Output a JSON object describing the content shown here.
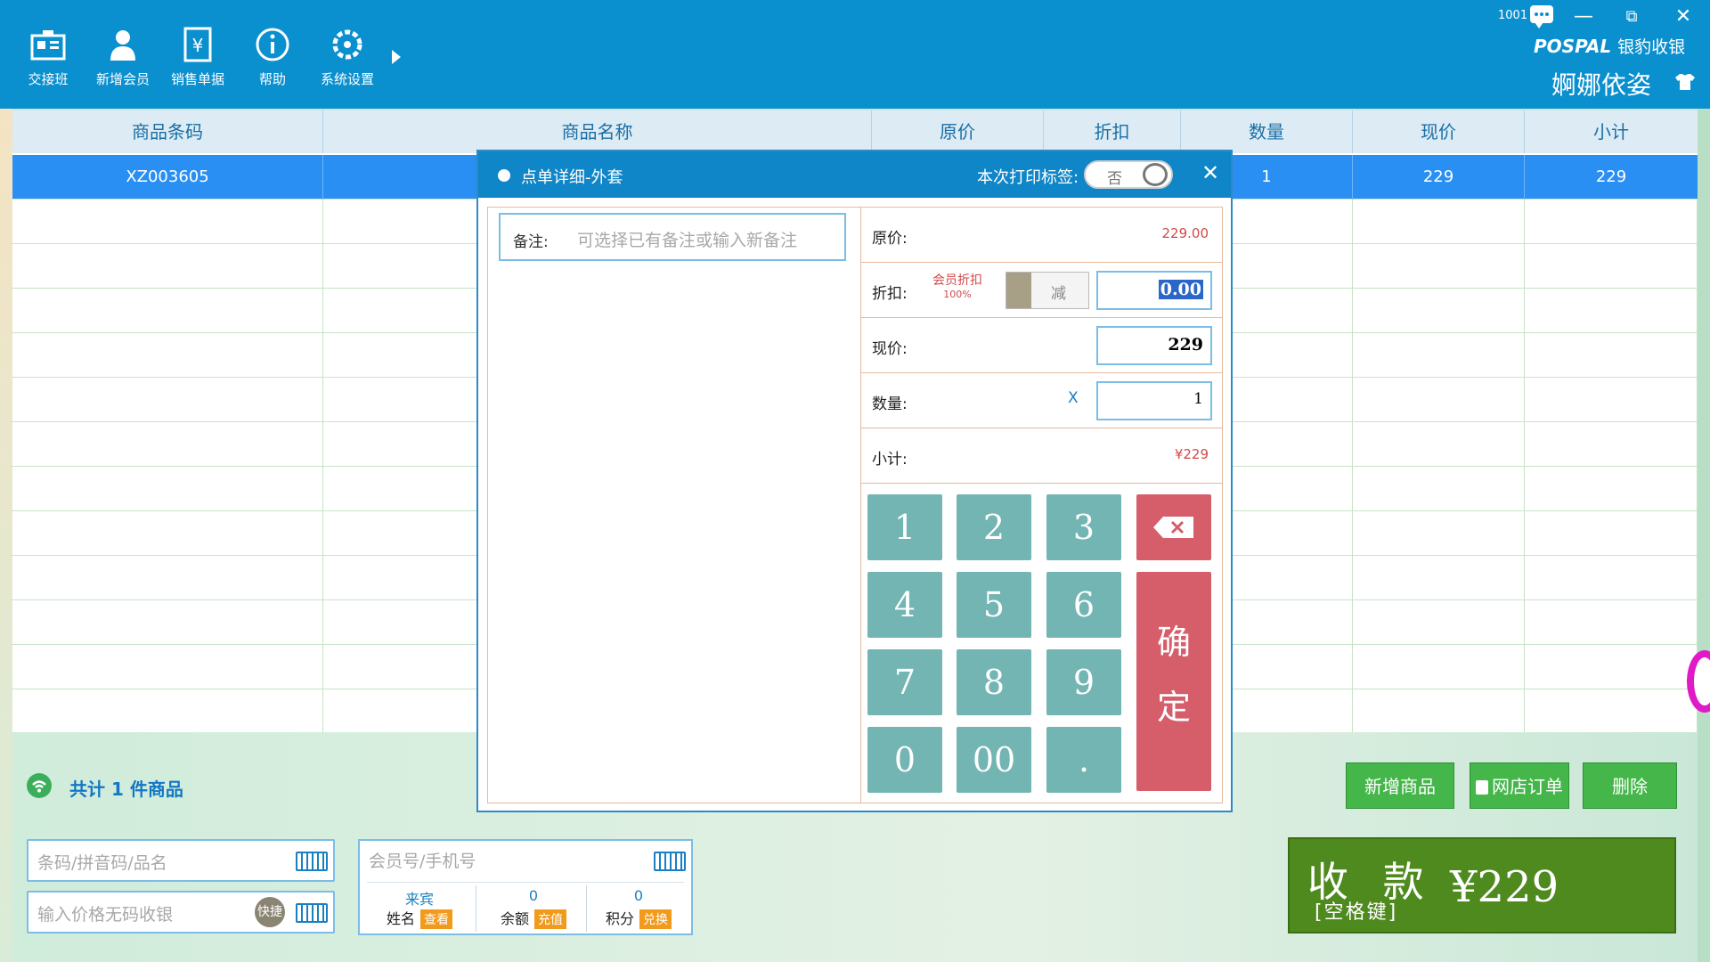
{
  "toolbar": {
    "items": [
      {
        "label": "交接班",
        "icon": "shift-change-icon"
      },
      {
        "label": "新增会员",
        "icon": "add-member-icon"
      },
      {
        "label": "销售单据",
        "icon": "sales-receipt-icon"
      },
      {
        "label": "帮助",
        "icon": "help-icon"
      },
      {
        "label": "系统设置",
        "icon": "settings-icon"
      }
    ]
  },
  "header": {
    "cashier_id": "1001",
    "brand": "POSPAL",
    "brand_cn": "银豹收银",
    "shop_name": "婀娜依姿"
  },
  "window": {
    "minimize": "—",
    "restore": "⧉",
    "close": "✕"
  },
  "table": {
    "columns": [
      "商品条码",
      "商品名称",
      "原价",
      "折扣",
      "数量",
      "现价",
      "小计"
    ],
    "rows": [
      {
        "barcode": "XZ003605",
        "name": "",
        "original": "",
        "discount": "",
        "qty": "1",
        "price": "229",
        "subtotal": "229"
      }
    ]
  },
  "footer": {
    "count_text": "共计  1  件商品",
    "buttons": {
      "add_item": "新增商品",
      "online_order": "网店订单",
      "delete": "删除"
    },
    "barcode_placeholder": "条码/拼音码/品名",
    "price_placeholder": "输入价格无码收银",
    "quick_label": "快捷",
    "member_placeholder": "会员号/手机号",
    "member": {
      "name_value": "来宾",
      "name_label": "姓名",
      "name_tag": "查看",
      "balance_value": "0",
      "balance_label": "余额",
      "balance_tag": "充值",
      "points_value": "0",
      "points_label": "积分",
      "points_tag": "兑换"
    },
    "pay": {
      "label": "收 款",
      "hint": "[空格键]",
      "amount": "¥229"
    }
  },
  "modal": {
    "title": "点单详细-外套",
    "print_label": "本次打印标签:",
    "print_toggle": "否",
    "close": "✕",
    "note_label": "备注:",
    "note_placeholder": "可选择已有备注或输入新备注",
    "original_label": "原价:",
    "original_value": "229.00",
    "discount_label": "折扣:",
    "member_discount": "会员折扣",
    "member_discount_pct": "100%",
    "discount_mode": "减",
    "discount_value": "0.00",
    "price_label": "现价:",
    "price_value": "229",
    "qty_label": "数量:",
    "qty_x": "X",
    "qty_value": "1",
    "subtotal_label": "小计:",
    "subtotal_value": "¥229",
    "keys": [
      "1",
      "2",
      "3",
      "4",
      "5",
      "6",
      "7",
      "8",
      "9",
      "0",
      "00",
      "."
    ],
    "confirm": [
      "确",
      "定"
    ]
  },
  "colors": {
    "topbar": "#0a8fcf",
    "selected_row": "#2a8ff2",
    "key": "#72b5b3",
    "confirm": "#d65d6a",
    "pay": "#4e8a1e",
    "green_btn": "#45b64a"
  }
}
